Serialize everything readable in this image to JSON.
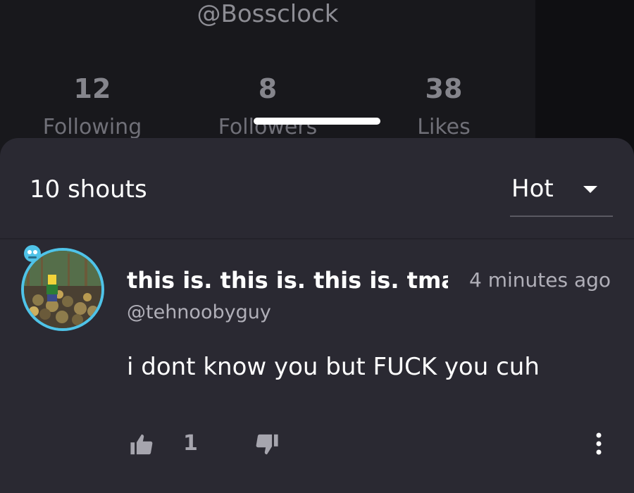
{
  "profile": {
    "handle": "@Bossclock",
    "stats": [
      {
        "count": "12",
        "label": "Following"
      },
      {
        "count": "8",
        "label": "Followers"
      },
      {
        "count": "38",
        "label": "Likes"
      }
    ]
  },
  "shouts": {
    "count_label": "10 shouts",
    "sort": {
      "selected": "Hot"
    }
  },
  "shout": {
    "author_name": "this is. this is. this is. tmar",
    "author_handle": "@tehnoobyguy",
    "time": "4 minutes ago",
    "body": "i dont know you but FUCK you cuh",
    "likes": "1"
  },
  "colors": {
    "background": "#18181c",
    "sheet": "#2a2932",
    "avatar_ring": "#4fc3e8",
    "text_primary": "#ffffff",
    "text_secondary": "#b0afb8"
  },
  "icons": {
    "like": "thumbs-up-icon",
    "dislike": "thumbs-down-icon",
    "more": "more-vertical-icon",
    "sort": "caret-down-icon"
  }
}
